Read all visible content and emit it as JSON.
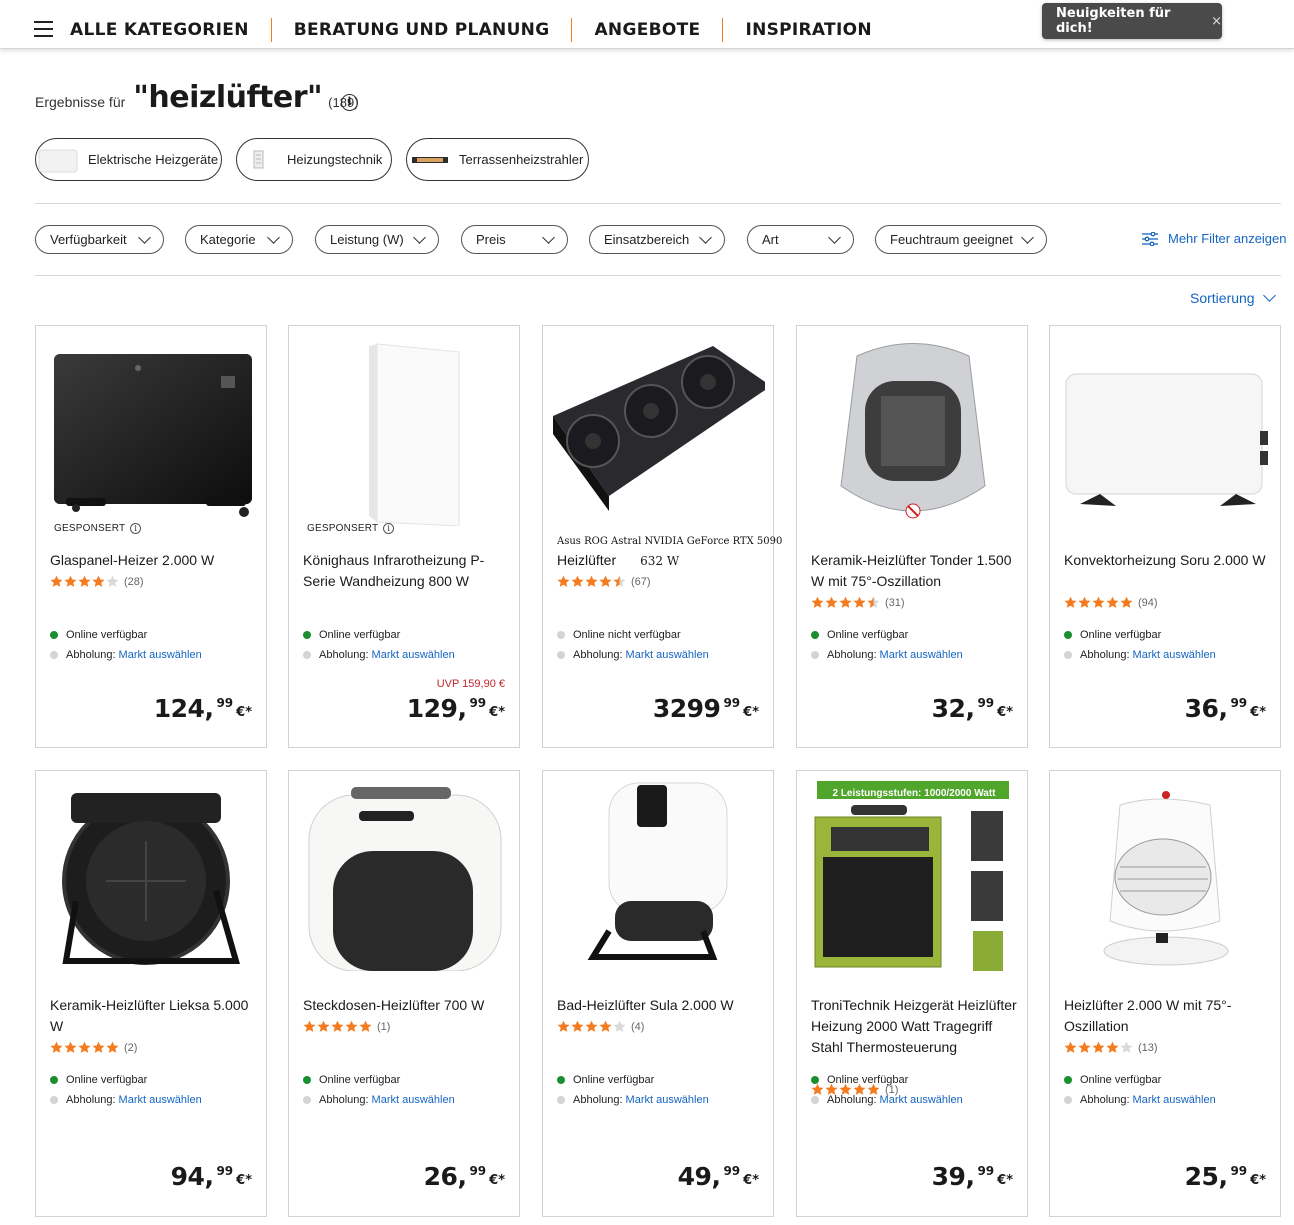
{
  "nav": {
    "items": [
      "ALLE KATEGORIEN",
      "BERATUNG UND PLANUNG",
      "ANGEBOTE",
      "INSPIRATION"
    ],
    "toast": "Neuigkeiten für dich!",
    "toast_close": "×"
  },
  "search": {
    "prefix": "Ergebnisse für",
    "query": "\"heizlüfter\"",
    "count": "(189)",
    "info": "i"
  },
  "categories": [
    "Elektrische Heizgeräte",
    "Heizungstechnik",
    "Terrassenheizstrahler"
  ],
  "filters": [
    "Verfügbarkeit",
    "Kategorie",
    "Leistung (W)",
    "Preis",
    "Einsatzbereich",
    "Art",
    "Feuchtraum geeignet"
  ],
  "more_filters": "Mehr Filter anzeigen",
  "sort": "Sortierung",
  "sponsored_label": "GESPONSERT",
  "pickup_label": "Abholung:",
  "pickup_link": "Markt auswählen",
  "currency": "€*",
  "colors": {
    "accent": "#f47b20",
    "link": "#1565c0",
    "available": "#1b8f2e",
    "uvp": "#c0272d"
  },
  "products": [
    {
      "name": "Glaspanel-Heizer 2.000 W",
      "sponsored": true,
      "rating": 4,
      "reviews": "(28)",
      "online": "Online verfügbar",
      "online_ok": true,
      "price": "124,",
      "cents": "99",
      "uvp": ""
    },
    {
      "name": "Könighaus Infrarotheizung P-Serie Wandheizung 800 W",
      "sponsored": true,
      "rating": 0,
      "reviews": "",
      "online": "Online verfügbar",
      "online_ok": true,
      "price": "129,",
      "cents": "99",
      "uvp": "UVP 159,90 €"
    },
    {
      "overlay": "Asus ROG Astral NVIDIA GeForce RTX 5090",
      "name": "Heizlüfter",
      "name_suffix": "632 W",
      "sponsored": false,
      "rating": 4.5,
      "reviews": "(67)",
      "online": "Online nicht verfügbar",
      "online_ok": false,
      "price": "3299",
      "cents": "99",
      "uvp": ""
    },
    {
      "name": "Keramik-Heizlüfter Tonder 1.500 W mit 75°-Oszillation",
      "sponsored": false,
      "rating": 4.5,
      "reviews": "(31)",
      "online": "Online verfügbar",
      "online_ok": true,
      "price": "32,",
      "cents": "99",
      "uvp": ""
    },
    {
      "name": "Konvektorheizung Soru 2.000 W",
      "sponsored": false,
      "rating": 5,
      "reviews": "(94)",
      "online": "Online verfügbar",
      "online_ok": true,
      "price": "36,",
      "cents": "99",
      "uvp": ""
    },
    {
      "name": "Keramik-Heizlüfter Lieksa 5.000 W",
      "sponsored": false,
      "rating": 5,
      "reviews": "(2)",
      "online": "Online verfügbar",
      "online_ok": true,
      "price": "94,",
      "cents": "99",
      "uvp": ""
    },
    {
      "name": "Steckdosen-Heizlüfter 700 W",
      "sponsored": false,
      "rating": 5,
      "reviews": "(1)",
      "online": "Online verfügbar",
      "online_ok": true,
      "price": "26,",
      "cents": "99",
      "uvp": ""
    },
    {
      "name": "Bad-Heizlüfter Sula 2.000 W",
      "sponsored": false,
      "rating": 4,
      "reviews": "(4)",
      "online": "Online verfügbar",
      "online_ok": true,
      "price": "49,",
      "cents": "99",
      "uvp": ""
    },
    {
      "name": "TroniTechnik Heizgerät Heizlüfter Heizung 2000 Watt Tragegriff Stahl Thermosteuerung",
      "sponsored": false,
      "rating": 5,
      "reviews": "(1)",
      "online": "Online verfügbar",
      "online_ok": true,
      "price": "39,",
      "cents": "99",
      "uvp": "",
      "banner": "2 Leistungsstufen: 1000/2000 Watt"
    },
    {
      "name": "Heizlüfter 2.000 W mit 75°-Oszillation",
      "sponsored": false,
      "rating": 4,
      "reviews": "(13)",
      "online": "Online verfügbar",
      "online_ok": true,
      "price": "25,",
      "cents": "99",
      "uvp": ""
    }
  ]
}
